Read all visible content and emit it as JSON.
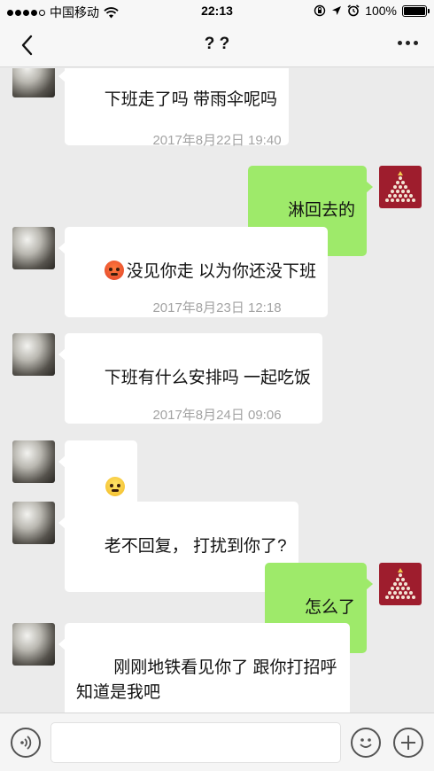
{
  "status_bar": {
    "carrier": "中国移动",
    "time": "22:13",
    "battery": "100%",
    "battery_level": 1.0,
    "icons": [
      "signal-icon",
      "wifi-icon",
      "orientation-lock-icon",
      "location-icon",
      "alarm-icon",
      "battery-icon"
    ]
  },
  "nav": {
    "title": "? ?",
    "back_icon": "chevron-left-icon",
    "more_icon": "more-icon"
  },
  "messages": {
    "m0": {
      "side": "left",
      "text": "下班走了吗 带雨伞呢吗"
    },
    "t1": {
      "text": "2017年8月22日 19:40"
    },
    "m1": {
      "side": "right",
      "text": "淋回去的"
    },
    "m2": {
      "side": "left",
      "emoji": "angry-face-emoji",
      "text": "没见你走 以为你还没下班"
    },
    "t2": {
      "text": "2017年8月23日 12:18"
    },
    "m3": {
      "side": "left",
      "text": "下班有什么安排吗 一起吃饭"
    },
    "t3": {
      "text": "2017年8月24日 09:06"
    },
    "m4": {
      "side": "left",
      "emoji": "shy-face-emoji"
    },
    "m5": {
      "side": "left",
      "text": "老不回复， 打扰到你了?"
    },
    "m6": {
      "side": "right",
      "text": "怎么了"
    },
    "m7": {
      "side": "left",
      "text": "  刚刚地铁看见你了 跟你打招呼\n知道是我吧"
    }
  },
  "colors": {
    "background": "#ebebeb",
    "bubble_sent": "#9eea6a",
    "bubble_received": "#ffffff",
    "timestamp": "#a3a3a3"
  },
  "input_bar": {
    "voice_icon": "voice-icon",
    "emoji_icon": "emoji-icon",
    "plus_icon": "plus-icon"
  }
}
